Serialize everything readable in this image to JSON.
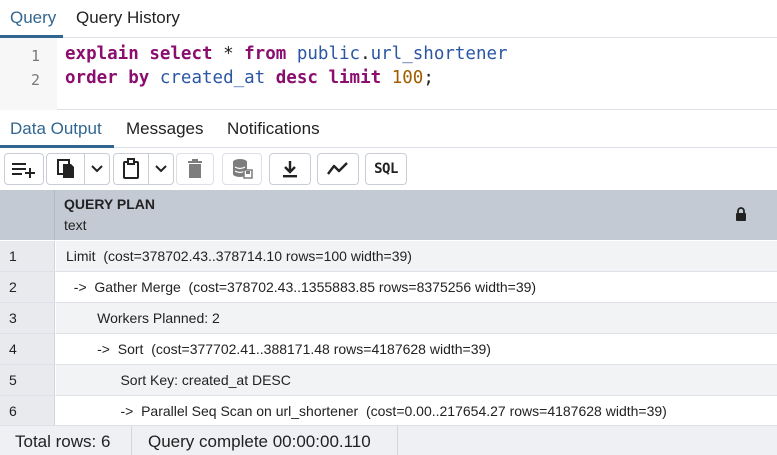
{
  "tabs": [
    {
      "label": "Query",
      "active": true
    },
    {
      "label": "Query History",
      "active": false
    }
  ],
  "editor": {
    "line_numbers": [
      "1",
      "2"
    ],
    "lines": [
      [
        {
          "t": "explain",
          "k": "kw"
        },
        {
          "t": " ",
          "k": "plain"
        },
        {
          "t": "select",
          "k": "kw"
        },
        {
          "t": " * ",
          "k": "plain"
        },
        {
          "t": "from",
          "k": "kw"
        },
        {
          "t": " ",
          "k": "plain"
        },
        {
          "t": "public",
          "k": "id"
        },
        {
          "t": ".",
          "k": "plain"
        },
        {
          "t": "url_shortener",
          "k": "id"
        }
      ],
      [
        {
          "t": "order",
          "k": "kw"
        },
        {
          "t": " ",
          "k": "plain"
        },
        {
          "t": "by",
          "k": "kw"
        },
        {
          "t": " ",
          "k": "plain"
        },
        {
          "t": "created_at",
          "k": "id"
        },
        {
          "t": " ",
          "k": "plain"
        },
        {
          "t": "desc",
          "k": "kw"
        },
        {
          "t": " ",
          "k": "plain"
        },
        {
          "t": "limit",
          "k": "kw"
        },
        {
          "t": " ",
          "k": "plain"
        },
        {
          "t": "100",
          "k": "num"
        },
        {
          "t": ";",
          "k": "plain"
        }
      ]
    ]
  },
  "result_tabs": [
    {
      "label": "Data Output",
      "active": true
    },
    {
      "label": "Messages",
      "active": false
    },
    {
      "label": "Notifications",
      "active": false
    }
  ],
  "toolbar": {
    "icons": [
      "add-row-icon",
      "copy-icon",
      "copy-options-chevron-icon",
      "paste-icon",
      "paste-options-chevron-icon",
      "delete-icon",
      "save-data-icon",
      "download-icon",
      "graph-visualiser-icon"
    ],
    "sql_label": "SQL"
  },
  "grid": {
    "column": {
      "name": "QUERY PLAN",
      "type": "text"
    },
    "rows": [
      {
        "num": "1",
        "text": "Limit  (cost=378702.43..378714.10 rows=100 width=39)"
      },
      {
        "num": "2",
        "text": "  ->  Gather Merge  (cost=378702.43..1355883.85 rows=8375256 width=39)"
      },
      {
        "num": "3",
        "text": "        Workers Planned: 2"
      },
      {
        "num": "4",
        "text": "        ->  Sort  (cost=377702.41..388171.48 rows=4187628 width=39)"
      },
      {
        "num": "5",
        "text": "              Sort Key: created_at DESC"
      },
      {
        "num": "6",
        "text": "              ->  Parallel Seq Scan on url_shortener  (cost=0.00..217654.27 rows=4187628 width=39)"
      }
    ]
  },
  "status": {
    "total_rows": "Total rows: 6",
    "query_status": "Query complete 00:00:00.110"
  },
  "colors": {
    "accent": "#326690",
    "keyword": "#8b0e6f",
    "identifier": "#2b56a4",
    "number": "#a15c00",
    "header_bg": "#c4cad4"
  }
}
